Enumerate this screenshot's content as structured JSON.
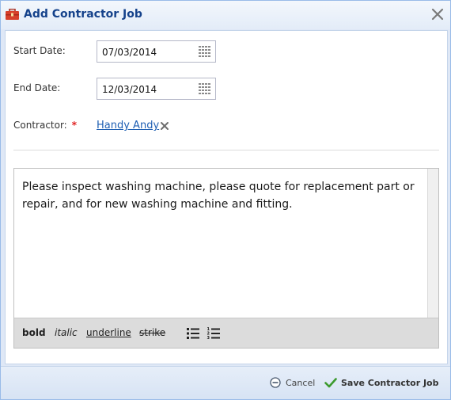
{
  "dialog": {
    "title": "Add Contractor Job",
    "title_icon": "toolbox-icon",
    "close_icon": "close-icon"
  },
  "form": {
    "start_date_label": "Start Date:",
    "start_date_value": "07/03/2014",
    "end_date_label": "End Date:",
    "end_date_value": "12/03/2014",
    "date_picker_icon": "calendar-icon",
    "contractor_label": "Contractor:",
    "required_marker": "*",
    "contractor_value": "Handy Andy",
    "remove_icon": "remove-icon"
  },
  "editor": {
    "content": "Please inspect washing machine, please quote for replacement part or repair, and for new washing machine and fitting.",
    "toolbar": {
      "bold": "bold",
      "italic": "italic",
      "underline": "underline",
      "strike": "strike",
      "bullet_list_icon": "bullet-list-icon",
      "numbered_list_icon": "numbered-list-icon"
    }
  },
  "footer": {
    "cancel_label": "Cancel",
    "save_label": "Save Contractor Job"
  },
  "colors": {
    "title": "#15428b",
    "link": "#1f5fb3",
    "required": "#e02020",
    "save_check": "#3c9a2e"
  }
}
